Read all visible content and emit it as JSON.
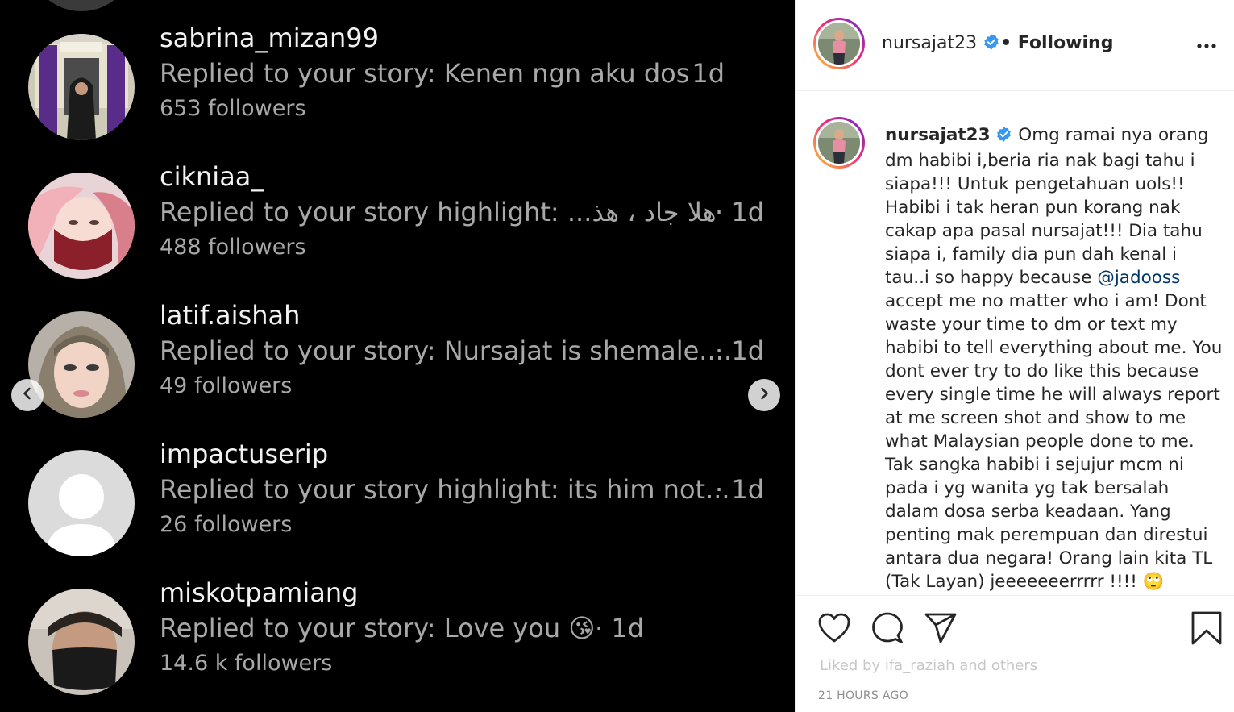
{
  "dm_list": [
    {
      "username": "sabrina_mizan99",
      "reply": "Replied to your story: Kenen ngn aku dos",
      "time": "· 1d",
      "followers": "653 followers"
    },
    {
      "username": "cikniaa_",
      "reply": "Replied to your story highlight: ",
      "reply_arabic": "هلا جاد ، هذ...",
      "time": "· 1d",
      "followers": "488 followers"
    },
    {
      "username": "latif.aishah",
      "reply": "Replied to your story: Nursajat is shemale....",
      "time": "· 1d",
      "followers": "49 followers"
    },
    {
      "username": "impactuserip",
      "reply": "Replied to your story highlight: its him not...",
      "time": "· 1d",
      "followers": "26 followers"
    },
    {
      "username": "miskotpamiang",
      "reply": "Replied to your story: Love you",
      "reply_emoji": "😘",
      "time": "· 1d",
      "followers": "14.6 k followers"
    }
  ],
  "nav": {
    "prev_icon": "chevron-left-icon",
    "next_icon": "chevron-right-icon"
  },
  "post_header": {
    "username": "nursajat23",
    "separator": "•",
    "follow_status": "Following",
    "more_icon": "more-horizontal-icon"
  },
  "caption": {
    "username": "nursajat23",
    "text_before_mention": "Omg ramai nya orang dm habibi i,beria ria nak bagi tahu i siapa!!! Untuk pengetahuan uols!! Habibi i tak heran pun korang nak cakap apa pasal nursajat!!! Dia tahu siapa i, family dia pun dah kenal i tau..i so happy because ",
    "mention": "@jadooss",
    "text_after_mention": " accept me no matter who i am! Dont waste your time to dm or text my habibi to tell everything about me. You dont ever try to do like this because every single time he will always report at me screen shot and show to me what Malaysian people done to me. Tak sangka habibi i sejujur mcm ni pada i yg wanita yg tak bersalah dalam dosa serba keadaan. Yang penting mak perempuan dan direstui antara dua negara! Orang lain kita TL (Tak Layan) jeeeeeeerrrrr !!!! ",
    "emoji": "🙄"
  },
  "actions": {
    "like_icon": "heart-icon",
    "comment_icon": "comment-icon",
    "share_icon": "share-icon",
    "save_icon": "bookmark-icon"
  },
  "likes_text": "Liked by ifa_raziah and others",
  "timestamp": "21 HOURS AGO",
  "colors": {
    "verified": "#3897f0",
    "mention": "#00376b",
    "dm_background": "#000000"
  }
}
